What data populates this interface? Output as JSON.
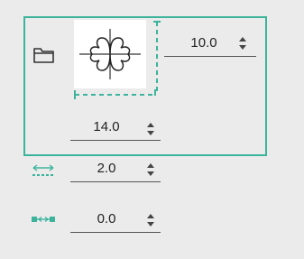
{
  "fields": {
    "width": {
      "value": "10.0"
    },
    "height": {
      "value": "14.0"
    },
    "spacing": {
      "value": "2.0"
    },
    "padding": {
      "value": "0.0"
    }
  },
  "icons": {
    "folder": "folder-icon",
    "shape_preview": "four-leaf-clover-icon",
    "spacing": "horizontal-spacing-icon",
    "padding": "horizontal-padding-icon",
    "spinner": "up-down-spinner-icon"
  },
  "colors": {
    "accent": "#3cb49c",
    "background": "#ebebeb",
    "preview_bg": "#ffffff",
    "text": "#222222"
  }
}
